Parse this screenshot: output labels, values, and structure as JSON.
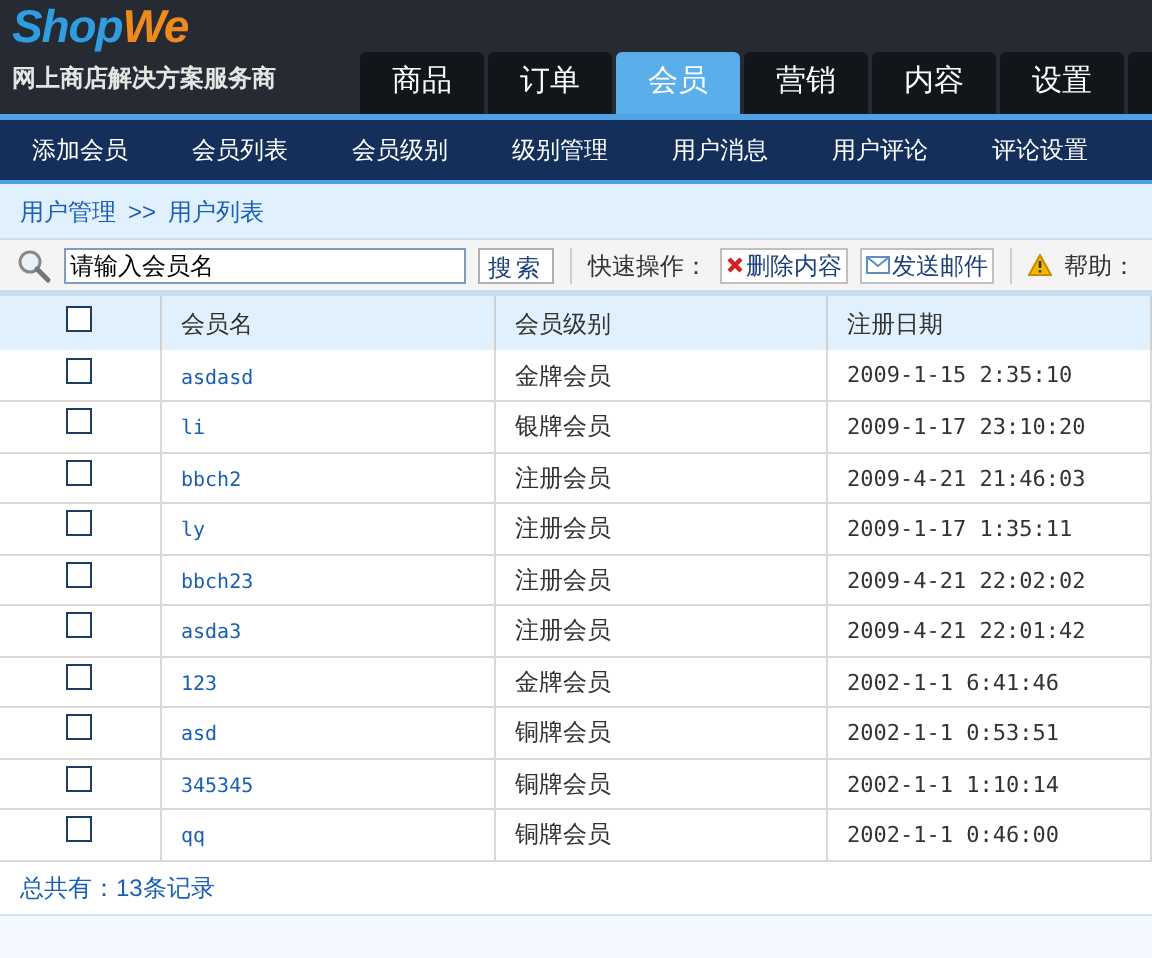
{
  "logo": {
    "first": "Shop",
    "second": "We",
    "tagline": "网上商店解决方案服务商"
  },
  "tabs": [
    {
      "label": "商品",
      "selected": false
    },
    {
      "label": "订单",
      "selected": false
    },
    {
      "label": "会员",
      "selected": true
    },
    {
      "label": "营销",
      "selected": false
    },
    {
      "label": "内容",
      "selected": false
    },
    {
      "label": "设置",
      "selected": false
    }
  ],
  "subnav": [
    "添加会员",
    "会员列表",
    "会员级别",
    "级别管理",
    "用户消息",
    "用户评论",
    "评论设置"
  ],
  "breadcrumb": {
    "parent": "用户管理",
    "separator": ">>",
    "current": "用户列表"
  },
  "toolbar": {
    "search_placeholder": "请输入会员名",
    "search_button": "搜索",
    "quick_label": "快速操作：",
    "delete_button": "删除内容",
    "mail_button": "发送邮件",
    "help": "帮助："
  },
  "table": {
    "columns": [
      "会员名",
      "会员级别",
      "注册日期"
    ],
    "header_checked": false,
    "rows": [
      {
        "checked": false,
        "name": "asdasd",
        "level": "金牌会员",
        "date": "2009-1-15 2:35:10"
      },
      {
        "checked": false,
        "name": "li",
        "level": "银牌会员",
        "date": "2009-1-17 23:10:20"
      },
      {
        "checked": false,
        "name": "bbch2",
        "level": "注册会员",
        "date": "2009-4-21 21:46:03"
      },
      {
        "checked": false,
        "name": "ly",
        "level": "注册会员",
        "date": "2009-1-17 1:35:11"
      },
      {
        "checked": false,
        "name": "bbch23",
        "level": "注册会员",
        "date": "2009-4-21 22:02:02"
      },
      {
        "checked": false,
        "name": "asda3",
        "level": "注册会员",
        "date": "2009-4-21 22:01:42"
      },
      {
        "checked": false,
        "name": "123",
        "level": "金牌会员",
        "date": "2002-1-1 6:41:46"
      },
      {
        "checked": false,
        "name": "asd",
        "level": "铜牌会员",
        "date": "2002-1-1 0:53:51"
      },
      {
        "checked": false,
        "name": "345345",
        "level": "铜牌会员",
        "date": "2002-1-1 1:10:14"
      },
      {
        "checked": false,
        "name": "qq",
        "level": "铜牌会员",
        "date": "2002-1-1 0:46:00"
      }
    ]
  },
  "footer": "总共有：13条记录"
}
